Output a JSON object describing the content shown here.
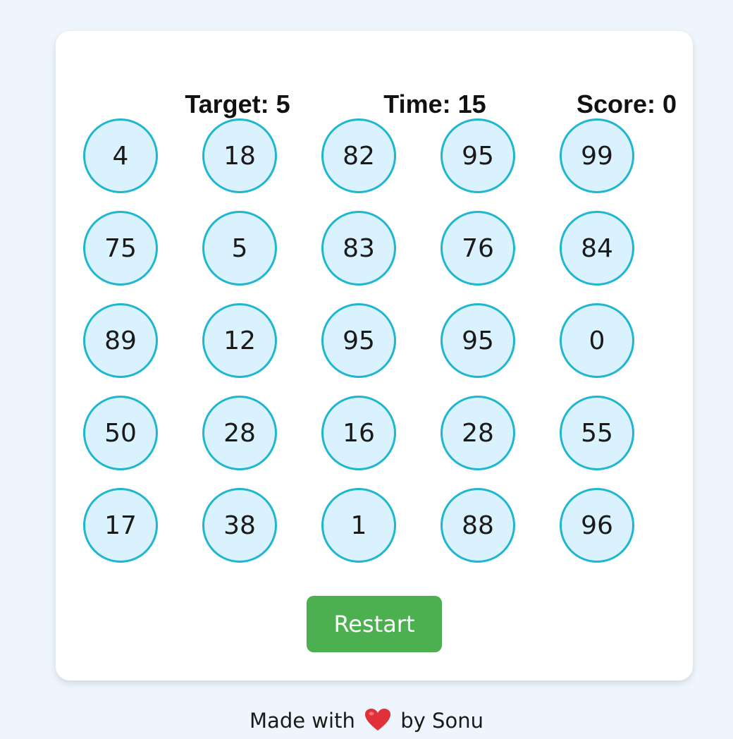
{
  "stats": {
    "target": "Target: 5",
    "time": "Time: 15",
    "score": "Score: 0"
  },
  "grid": {
    "rows": [
      [
        "4",
        "18",
        "82",
        "95",
        "99"
      ],
      [
        "75",
        "5",
        "83",
        "76",
        "84"
      ],
      [
        "89",
        "12",
        "95",
        "95",
        "0"
      ],
      [
        "50",
        "28",
        "16",
        "28",
        "55"
      ],
      [
        "17",
        "38",
        "1",
        "88",
        "96"
      ]
    ]
  },
  "restart_label": "Restart",
  "footer": {
    "made_with": "Made with",
    "by": "by Sonu",
    "heart_icon": "heart-icon"
  },
  "colors": {
    "circle_border": "#1fb6cf",
    "circle_fill": "#daf2fd",
    "restart_bg": "#4caf50",
    "heart": "#e0303a",
    "page_bg": "#eef5fd"
  }
}
